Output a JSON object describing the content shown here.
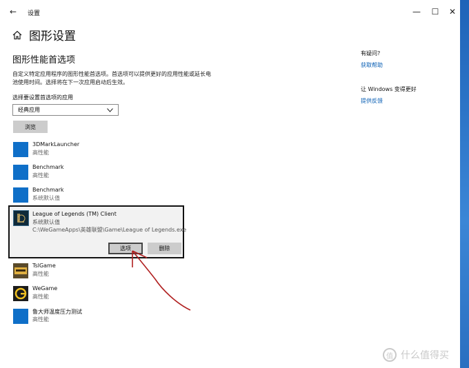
{
  "window": {
    "title": "设置",
    "back_label": "←",
    "minimize_label": "—",
    "maximize_label": "☐",
    "close_label": "✕"
  },
  "page": {
    "title": "图形设置",
    "home_icon": "home-icon"
  },
  "section": {
    "title": "图形性能首选项",
    "description": "自定义特定应用程序的图形性能首选项。首选项可以提供更好的应用性能或延长电池使用时间。选择将在下一次应用启动后生效。",
    "select_label": "选择要设置首选项的应用",
    "dropdown_value": "经典应用",
    "browse_label": "浏览"
  },
  "apps": [
    {
      "name": "3DMarkLauncher",
      "pref": "高性能"
    },
    {
      "name": "Benchmark",
      "pref": "高性能"
    },
    {
      "name": "Benchmark",
      "pref": "系统默认值"
    }
  ],
  "selected_app": {
    "name": "League of Legends (TM) Client",
    "pref": "系统默认值",
    "path": "C:\\WeGameApps\\英雄联盟\\Game\\League of Legends.exe",
    "options_label": "选项",
    "remove_label": "删除"
  },
  "apps_after": [
    {
      "name": "TslGame",
      "pref": "高性能"
    },
    {
      "name": "WeGame",
      "pref": "高性能"
    },
    {
      "name": "鲁大师温度压力测试",
      "pref": "高性能"
    }
  ],
  "help_panel": {
    "question": "有疑问?",
    "help_link": "获取帮助",
    "improve": "让 Windows 变得更好",
    "feedback_link": "提供反馈"
  },
  "watermark": {
    "logo": "值",
    "text": "什么值得买"
  },
  "colors": {
    "accent": "#0f6fc8",
    "link": "#0a5fb4",
    "annotation_arrow": "#b02020"
  }
}
